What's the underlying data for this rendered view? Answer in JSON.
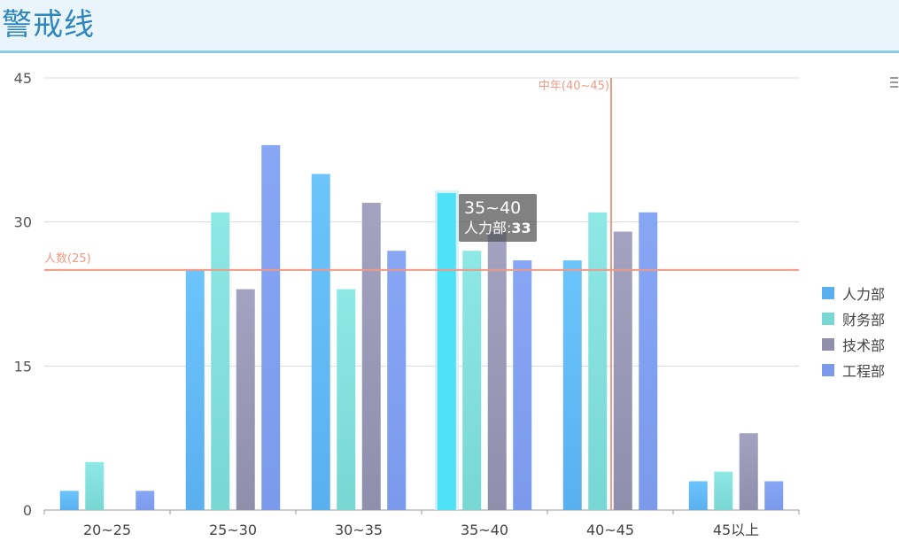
{
  "header": {
    "title": "警戒线"
  },
  "chart_data": {
    "type": "bar",
    "title": "",
    "xlabel": "",
    "ylabel": "",
    "ylim": [
      0,
      45
    ],
    "yticks": [
      0,
      15,
      30,
      45
    ],
    "grid": true,
    "legend_position": "right",
    "categories": [
      "20~25",
      "25~30",
      "30~35",
      "35~40",
      "40~45",
      "45以上"
    ],
    "series": [
      {
        "name": "人力部",
        "values": [
          2,
          25,
          35,
          33,
          26,
          3
        ],
        "color_top": "#6cc4fb",
        "color_bottom": "#5ab0ef"
      },
      {
        "name": "财务部",
        "values": [
          5,
          31,
          23,
          27,
          31,
          4
        ],
        "color_top": "#8ee8e5",
        "color_bottom": "#78d7d3"
      },
      {
        "name": "技术部",
        "values": [
          0,
          23,
          32,
          29,
          29,
          8
        ],
        "color_top": "#a3a3c1",
        "color_bottom": "#8f8fab"
      },
      {
        "name": "工程部",
        "values": [
          2,
          38,
          27,
          26,
          31,
          3
        ],
        "color_top": "#87a6f4",
        "color_bottom": "#7b9aeb"
      }
    ],
    "mark_lines": [
      {
        "axis": "y",
        "value": 25,
        "label": "人数(25)",
        "color": "#ef9a86"
      },
      {
        "axis": "x",
        "category": "40~45",
        "label": "中年(40~45)",
        "color": "#ef9a86"
      }
    ],
    "tooltip": {
      "category": "35~40",
      "series": "人力部",
      "series_label": "人力部:",
      "value": "33"
    },
    "highlight_color": "#4ee0f7"
  }
}
